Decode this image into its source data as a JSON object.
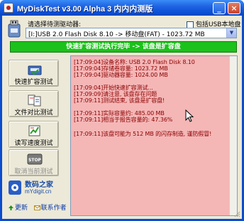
{
  "window": {
    "title": "MyDiskTest v3.00 Alpha 3 内内内测版",
    "minimize_label": "_",
    "close_label": "×"
  },
  "drive_select": {
    "label": "请选择待测驱动器:",
    "usb_checkbox_label": "包括USB本地盘",
    "usb_checkbox_checked": false,
    "dropdown_value": "[I:]USB 2.0 Flash Disk 8.10 -> 移动盘(FAT) - 1023.72 MB",
    "dropdown_arrow": "▼"
  },
  "banner": {
    "text": "快速扩容测试执行完毕 -> 该盘是扩容盘",
    "color": "#1cc11c"
  },
  "side_buttons": [
    {
      "label": "快速扩容测试",
      "icon": "disk-check-icon",
      "enabled": true
    },
    {
      "label": "文件对比测试",
      "icon": "file-compare-icon",
      "enabled": true
    },
    {
      "label": "读写速度测试",
      "icon": "speed-test-icon",
      "enabled": true
    },
    {
      "label": "取消当前测试",
      "icon": "stop-icon",
      "enabled": false
    }
  ],
  "stop_sign_text": "STOP",
  "logo": {
    "title": "数码之家",
    "url": "mYdigit.cn"
  },
  "bottom_links": {
    "update": "更新",
    "contact": "联系作者"
  },
  "log": {
    "background": "#f5b6b6",
    "lines": [
      "[17:09:04]设备名称: USB 2.0 Flash Disk 8.10",
      "[17:09:04]存储卷容量: 1023.72 MB",
      "[17:09:04]驱动器容量: 1024.00 MB",
      "",
      "[17:09:04]开始快速扩容测试...",
      "[17:09:09]请注意, 该盘存在问题",
      "[17:09:11]测试结束, 该盘是扩容盘!",
      "",
      "[17:09:11]实际容量约: 485.00 MB",
      "[17:09:11]相当于报告容量的: 47.36%",
      "",
      "[17:09:11]该盘可能为 512 MB 的闪存制造, 谨防假冒!"
    ]
  }
}
